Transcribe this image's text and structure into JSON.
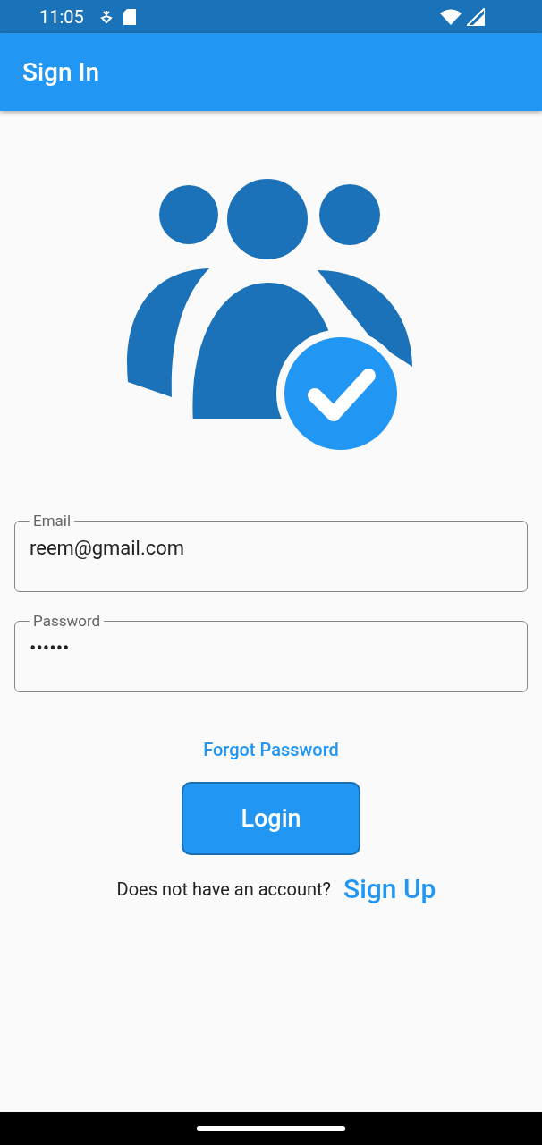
{
  "status_bar": {
    "time": "11:05"
  },
  "app_bar": {
    "title": "Sign In"
  },
  "fields": [
    {
      "label": "Email",
      "value": "reem@gmail.com"
    },
    {
      "label": "Password",
      "value": "••••••"
    }
  ],
  "forgot_link": "Forgot Password",
  "login_button": "Login",
  "signup": {
    "prompt": "Does not have an account?",
    "link": "Sign Up"
  }
}
